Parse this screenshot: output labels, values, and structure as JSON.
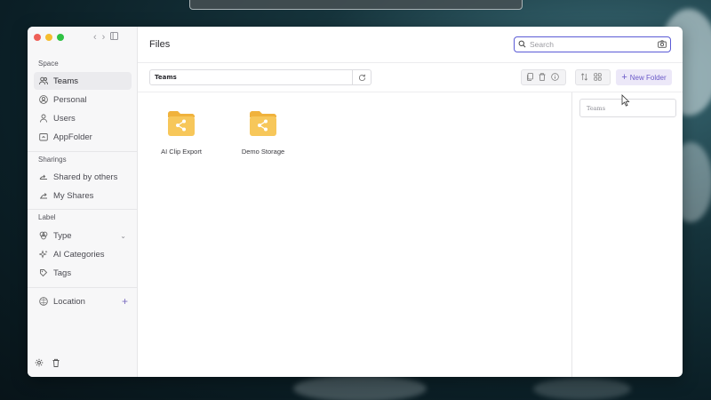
{
  "app": {
    "title": "Files"
  },
  "colors": {
    "accent": "#5b5bd6",
    "new_folder_bg": "#ece8f8",
    "folder": "#f6c14b"
  },
  "sidebar": {
    "sections": {
      "space": "Space",
      "sharings": "Sharings",
      "label": "Label"
    },
    "space_items": [
      {
        "label": "Teams",
        "icon": "users-icon",
        "active": true
      },
      {
        "label": "Personal",
        "icon": "user-circle-icon",
        "active": false
      },
      {
        "label": "Users",
        "icon": "user-icon",
        "active": false
      },
      {
        "label": "AppFolder",
        "icon": "app-folder-icon",
        "active": false
      }
    ],
    "sharing_items": [
      {
        "label": "Shared by others",
        "icon": "share-in-icon"
      },
      {
        "label": "My Shares",
        "icon": "share-out-icon"
      }
    ],
    "label_items": [
      {
        "label": "Type",
        "icon": "type-icon"
      },
      {
        "label": "AI Categories",
        "icon": "sparkles-icon"
      },
      {
        "label": "Tags",
        "icon": "tag-icon"
      }
    ],
    "location": {
      "label": "Location",
      "icon": "location-icon"
    }
  },
  "search": {
    "placeholder": "Search",
    "value": ""
  },
  "breadcrumb": {
    "path": "Teams"
  },
  "toolbar": {
    "new_folder_label": "New Folder"
  },
  "folders": [
    {
      "name": "AI Clip Export",
      "icon": "shared-folder-icon"
    },
    {
      "name": "Demo Storage",
      "icon": "shared-folder-icon"
    }
  ],
  "preview_panel": {
    "title": "Teams"
  }
}
